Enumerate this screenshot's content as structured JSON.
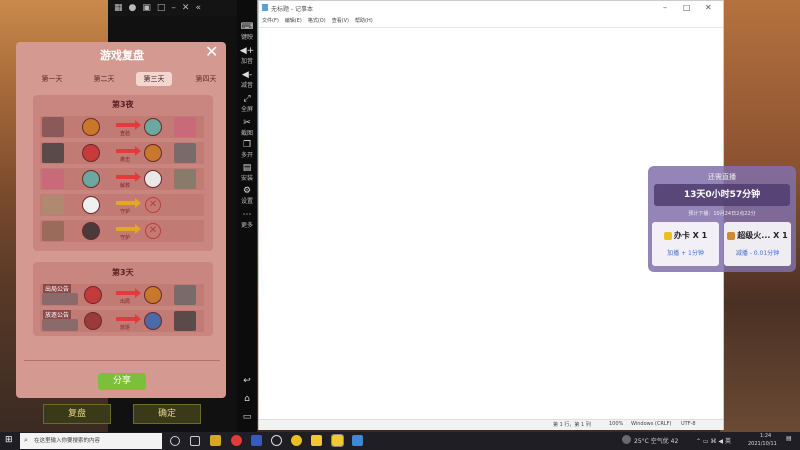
{
  "emulator": {
    "top_icons": [
      "grid-icon",
      "mic-icon",
      "folder-icon",
      "window-icon",
      "minimize-icon",
      "close-icon",
      "collapse-icon"
    ],
    "sidebar": [
      {
        "label": "键映",
        "icon": "keyboard-icon"
      },
      {
        "label": "加音",
        "icon": "volume-up-icon"
      },
      {
        "label": "减音",
        "icon": "volume-down-icon"
      },
      {
        "label": "全屏",
        "icon": "fullscreen-icon"
      },
      {
        "label": "截图",
        "icon": "scissors-icon"
      },
      {
        "label": "多开",
        "icon": "multi-open-icon"
      },
      {
        "label": "安装",
        "icon": "install-icon"
      },
      {
        "label": "设置",
        "icon": "gear-icon"
      },
      {
        "label": "更多",
        "icon": "more-icon"
      }
    ]
  },
  "game": {
    "title": "游戏复盘",
    "tabs": [
      "第一天",
      "第二天",
      "第三天",
      "第四天"
    ],
    "active_tab": 2,
    "night_section": {
      "title": "第3夜"
    },
    "night_rows": [
      {
        "action": "查验",
        "arrow": "red"
      },
      {
        "action": "袭击",
        "arrow": "red"
      },
      {
        "action": "解救",
        "arrow": "red"
      },
      {
        "action": "守护",
        "arrow": "yellow"
      },
      {
        "action": "守护",
        "arrow": "yellow"
      }
    ],
    "day_section": {
      "title": "第3天"
    },
    "day_rows": [
      {
        "tag": "出局公告",
        "action": "出局"
      },
      {
        "tag": "放逐公告",
        "action": "放逐"
      }
    ],
    "share_label": "分享",
    "review_label": "复盘",
    "confirm_label": "确定"
  },
  "notepad": {
    "title": "无标题 - 记事本",
    "menu": [
      "文件(F)",
      "编辑(E)",
      "格式(O)",
      "查看(V)",
      "帮助(H)"
    ],
    "status": {
      "position": "第 1 行，第 1 列",
      "zoom": "100%",
      "eol": "Windows (CRLF)",
      "encoding": "UTF-8"
    }
  },
  "live": {
    "title": "还需直播",
    "timer": "13天0小时57分钟",
    "next_drop": "预计下播：10月24日2点22分",
    "card1": {
      "title": "办卡 X 1",
      "sub": "加播 + 1分钟"
    },
    "card2": {
      "title": "超级火... X 1",
      "sub": "减播 - 0.01分钟"
    }
  },
  "taskbar": {
    "search_placeholder": "在这里输入你要搜索的内容",
    "weather": "25°C 空气优 42",
    "time": "1:24",
    "date": "2021/10/11"
  },
  "colors": {
    "game_panel": "#d49a92",
    "share_green": "#7bbf3a",
    "arrow_red": "#e23b3b",
    "arrow_yellow": "#e3a820",
    "live_bg": "#8070aa",
    "card_sub_blue": "#3b6fd6",
    "taskbar": "#1e1e24"
  }
}
